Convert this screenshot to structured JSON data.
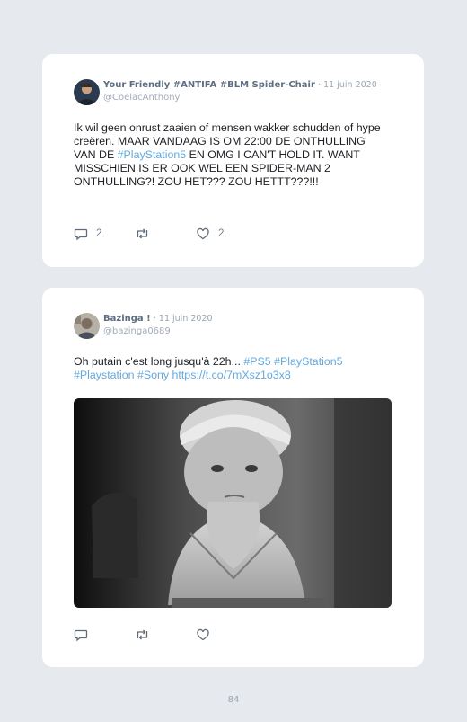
{
  "tweets": [
    {
      "author_name": "Your Friendly #ANTIFA #BLM Spider-Chair",
      "date": "· 11 juin 2020",
      "handle": "@CoelacAnthony",
      "text_part1": "Ik wil geen onrust zaaien of mensen wakker schudden of hype creëren. MAAR VANDAAG IS OM 22:00 DE ONTHULLING VAN DE ",
      "hashtag1": "#PlayStation5",
      "text_part2": " EN OMG I CAN'T HOLD IT. WANT MISSCHIEN IS ER OOK WEL EEN SPIDER-MAN 2 ONTHULLING?! ZOU HET??? ZOU HETTT???!!!",
      "reply_count": "2",
      "like_count": "2"
    },
    {
      "author_name": "Bazinga !",
      "date": "· 11 juin 2020",
      "handle": "@bazinga0689",
      "text_part1": "Oh putain c'est long jusqu'à 22h... ",
      "hashtags": "#PS5 #PlayStation5 #Playstation #Sony ",
      "link": "https://t.co/7mXsz1o3x8",
      "media_caption": "",
      "reply_count": "",
      "like_count": ""
    }
  ],
  "page_number": "84",
  "icons": [
    "reply-icon",
    "retweet-icon",
    "like-icon"
  ],
  "colors": {
    "link": "#63a9de",
    "name": "#5d6d82",
    "meta": "#9aa6b4",
    "background": "#e6e9ee"
  }
}
